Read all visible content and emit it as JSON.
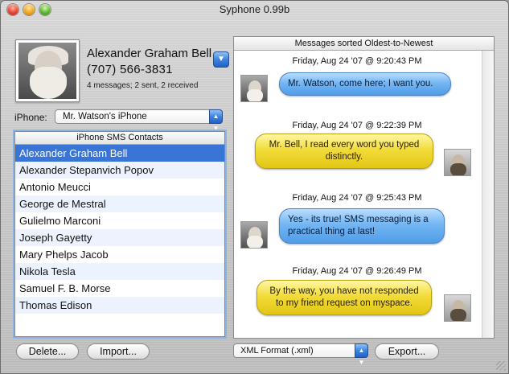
{
  "window": {
    "title": "Syphone 0.99b"
  },
  "contact": {
    "name": "Alexander Graham Bell",
    "phone": "(707) 566-3831",
    "stats": "4 messages; 2 sent, 2 received"
  },
  "iphone": {
    "label": "iPhone:",
    "selected": "Mr. Watson's iPhone"
  },
  "contacts": {
    "header": "iPhone SMS Contacts",
    "selected_index": 0,
    "items": [
      "Alexander Graham Bell",
      "Alexander Stepanvich Popov",
      "Antonio Meucci",
      "George de Mestral",
      "Gulielmo Marconi",
      "Joseph Gayetty",
      "Mary Phelps Jacob",
      "Nikola Tesla",
      "Samuel F. B. Morse",
      "Thomas Edison"
    ]
  },
  "messages": {
    "header": "Messages sorted Oldest-to-Newest",
    "items": [
      {
        "time": "Friday, Aug 24 '07 @ 9:20:43 PM",
        "direction": "received",
        "text": "Mr. Watson, come here; I want you."
      },
      {
        "time": "Friday, Aug 24 '07 @ 9:22:39 PM",
        "direction": "sent",
        "text": "Mr. Bell, I read every word you typed distinctly."
      },
      {
        "time": "Friday, Aug 24 '07 @ 9:25:43 PM",
        "direction": "received",
        "text": "Yes - its true! SMS messaging is a practical thing at last!"
      },
      {
        "time": "Friday, Aug 24 '07 @ 9:26:49 PM",
        "direction": "sent",
        "text": "By the way, you have not responded to my friend request on myspace."
      }
    ]
  },
  "buttons": {
    "delete": "Delete...",
    "import": "Import...",
    "export": "Export..."
  },
  "format": {
    "selected": "XML Format (.xml)"
  },
  "colors": {
    "selection": "#3875d7",
    "received_bubble": "#74b6f3",
    "sent_bubble": "#f2dc3a"
  }
}
